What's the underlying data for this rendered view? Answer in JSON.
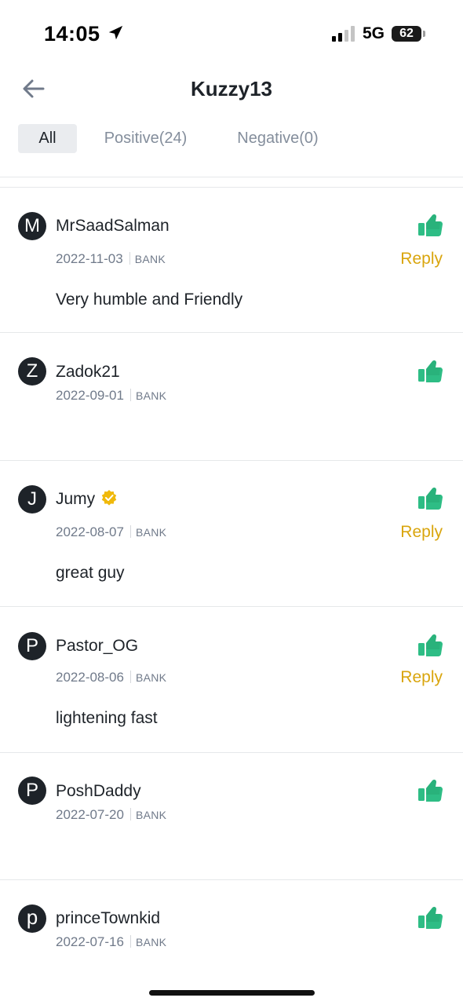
{
  "status_bar": {
    "time": "14:05",
    "network": "5G",
    "battery": "62",
    "icons": [
      "location-arrow-icon",
      "signal-bars-icon",
      "battery-icon"
    ]
  },
  "header": {
    "title": "Kuzzy13",
    "back_icon": "arrow-left-icon"
  },
  "tabs": [
    {
      "label": "All",
      "active": true
    },
    {
      "label": "Positive(24)",
      "active": false
    },
    {
      "label": "Negative(0)",
      "active": false
    }
  ],
  "colors": {
    "accent_yellow": "#d9a50d",
    "positive_green": "#2ebd85",
    "text_primary": "#1e2329",
    "text_secondary": "#707a8a"
  },
  "reviews": [
    {
      "initial": "M",
      "name": "MrSaadSalman",
      "verified": false,
      "date": "2022-11-03",
      "method": "BANK",
      "comment": "Very humble and Friendly",
      "reply": "Reply",
      "rating_icon": "thumbs-up-icon"
    },
    {
      "initial": "Z",
      "name": "Zadok21",
      "verified": false,
      "date": "2022-09-01",
      "method": "BANK",
      "comment": "",
      "reply": "",
      "rating_icon": "thumbs-up-icon"
    },
    {
      "initial": "J",
      "name": "Jumy",
      "verified": true,
      "date": "2022-08-07",
      "method": "BANK",
      "comment": "great guy",
      "reply": "Reply",
      "rating_icon": "thumbs-up-icon"
    },
    {
      "initial": "P",
      "name": "Pastor_OG",
      "verified": false,
      "date": "2022-08-06",
      "method": "BANK",
      "comment": "lightening fast",
      "reply": "Reply",
      "rating_icon": "thumbs-up-icon"
    },
    {
      "initial": "P",
      "name": "PoshDaddy",
      "verified": false,
      "date": "2022-07-20",
      "method": "BANK",
      "comment": "",
      "reply": "",
      "rating_icon": "thumbs-up-icon"
    },
    {
      "initial": "p",
      "name": "princeTownkid",
      "verified": false,
      "date": "2022-07-16",
      "method": "BANK",
      "comment": "",
      "reply": "",
      "rating_icon": "thumbs-up-icon"
    }
  ]
}
